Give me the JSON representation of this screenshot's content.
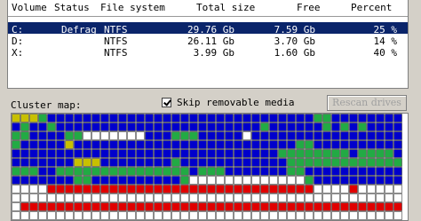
{
  "volume_table": {
    "headers": {
      "volume": "Volume",
      "status": "Status",
      "file_system": "File system",
      "total_size": "Total size",
      "free": "Free",
      "percent": "Percent"
    },
    "rows": [
      {
        "volume": "C:",
        "status": "Defrag",
        "file_system": "NTFS",
        "total_size": "29.76 Gb",
        "free": "7.59 Gb",
        "percent": "25 %",
        "selected": true
      },
      {
        "volume": "D:",
        "status": "",
        "file_system": "NTFS",
        "total_size": "26.11 Gb",
        "free": "3.70 Gb",
        "percent": "14 %",
        "selected": false
      },
      {
        "volume": "X:",
        "status": "",
        "file_system": "NTFS",
        "total_size": "3.99 Gb",
        "free": "1.60 Gb",
        "percent": "40 %",
        "selected": false
      }
    ]
  },
  "cluster_map": {
    "label": "Cluster map:",
    "skip_removable": {
      "label": "Skip removable media",
      "checked": true
    },
    "rescan_label": "Rescan drives",
    "colors": {
      "B": "#0000cc",
      "G": "#22aa44",
      "Y": "#c8c000",
      "W": "#ffffff",
      "R": "#e00000",
      "E": "#ffffff"
    }
  }
}
